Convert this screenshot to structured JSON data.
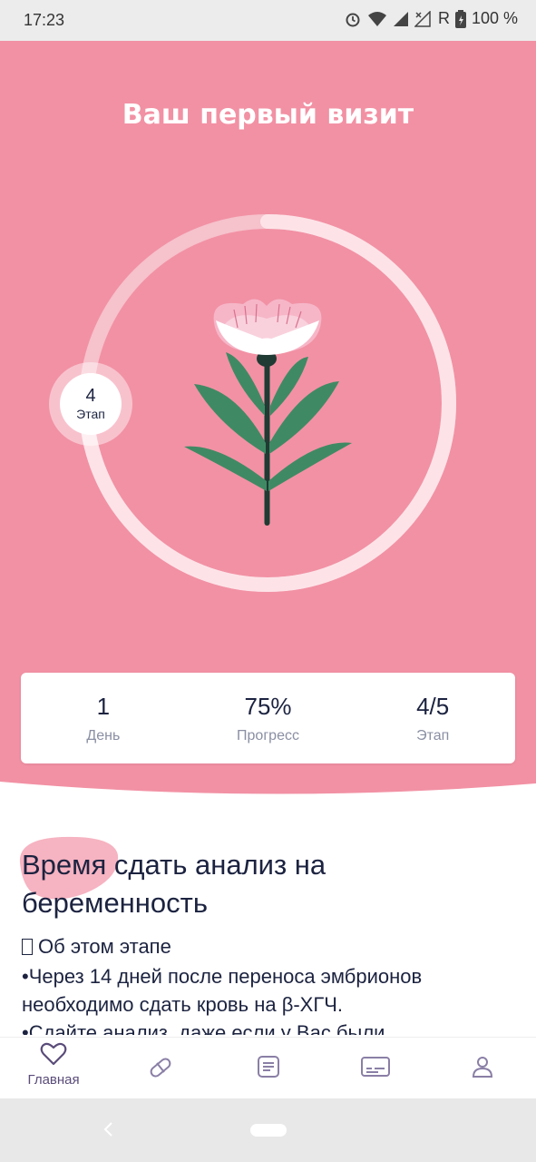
{
  "status_bar": {
    "time": "17:23",
    "carrier": "R",
    "battery": "100 %"
  },
  "hero": {
    "title": "Ваш первый визит"
  },
  "progress": {
    "stage_number": "4",
    "stage_label": "Этап",
    "fraction": 0.75
  },
  "stats": {
    "day": {
      "value": "1",
      "label": "День"
    },
    "progress": {
      "value": "75%",
      "label": "Прогресс"
    },
    "stage": {
      "value": "4/5",
      "label": "Этап"
    }
  },
  "content": {
    "headline": "Время сдать анализ на беременность",
    "about": "Об этом этапе",
    "body": "•Через 14 дней после переноса эмбрионов необходимо сдать кровь на β-ХГЧ.",
    "body_cut": "•Сдайте анализ, даже если у Вас были"
  },
  "nav": {
    "home_label": "Главная",
    "items": [
      "home-icon",
      "pill-icon",
      "notes-icon",
      "card-icon",
      "profile-icon"
    ]
  },
  "colors": {
    "hero_pink": "#f291a4",
    "accent": "#5a4c7a",
    "text": "#1c2340",
    "leaf": "#3f8a64"
  }
}
